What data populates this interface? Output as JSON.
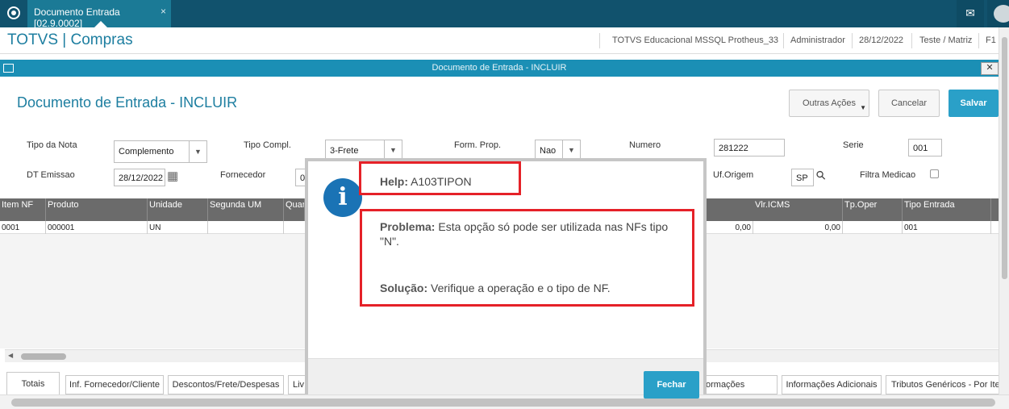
{
  "tab": {
    "title": "Documento Entrada [02.9.0002]",
    "close": "×"
  },
  "header": {
    "app_title": "TOTVS | Compras",
    "environment": "TOTVS Educacional MSSQL Protheus_33",
    "user": "Administrador",
    "date": "28/12/2022",
    "branch": "Teste / Matriz",
    "shortcut": "F1"
  },
  "window": {
    "title": "Documento de Entrada - INCLUIR",
    "close": "✕"
  },
  "page": {
    "title": "Documento de Entrada - INCLUIR"
  },
  "actions": {
    "other": "Outras Ações",
    "cancel": "Cancelar",
    "save": "Salvar"
  },
  "form": {
    "tipo_nota_label": "Tipo da Nota",
    "tipo_nota_value": "Complemento",
    "tipo_compl_label": "Tipo Compl.",
    "tipo_compl_value": "3-Frete",
    "form_prop_label": "Form. Prop.",
    "form_prop_value": "Nao",
    "numero_label": "Numero",
    "numero_value": "281222",
    "serie_label": "Serie",
    "serie_value": "001",
    "dt_emissao_label": "DT Emissao",
    "dt_emissao_value": "28/12/2022",
    "fornecedor_label": "Fornecedor",
    "fornecedor_value": "0",
    "uf_origem_label": "Uf.Origem",
    "uf_origem_value": "SP",
    "filtra_medicao_label": "Filtra Medicao"
  },
  "grid": {
    "columns": [
      "Item NF",
      "Produto",
      "Unidade",
      "Segunda UM",
      "Quan",
      "Vlr.ICMS",
      "Tp.Oper",
      "Tipo Entrada"
    ],
    "row": [
      "0001",
      "000001",
      "UN",
      "",
      "",
      "0,00",
      "0,00",
      "",
      "001"
    ]
  },
  "bottom_tabs": [
    "Totais",
    "Inf. Fornecedor/Cliente",
    "Descontos/Frete/Despesas",
    "Liv",
    "ormações DANFE",
    "Informações Adicionais",
    "Tributos Genéricos - Por Ite"
  ],
  "dialog": {
    "help_label": "Help:",
    "help_code": "A103TIPON",
    "problem_label": "Problema:",
    "problem_text": "Esta opção só pode ser utilizada nas NFs tipo \"N\".",
    "solution_label": "Solução:",
    "solution_text": "Verifique a operação e o tipo de NF.",
    "close_button": "Fechar",
    "info_glyph": "i"
  },
  "icons": {
    "mail": "✉",
    "search": "⚲",
    "calendar": "▦",
    "dropdown": "▼",
    "scroll_left": "◀"
  },
  "colors": {
    "accent": "#1b8fb5",
    "topbar": "#11526d",
    "highlight_border": "#e52128",
    "save_button": "#2aa0c8"
  }
}
